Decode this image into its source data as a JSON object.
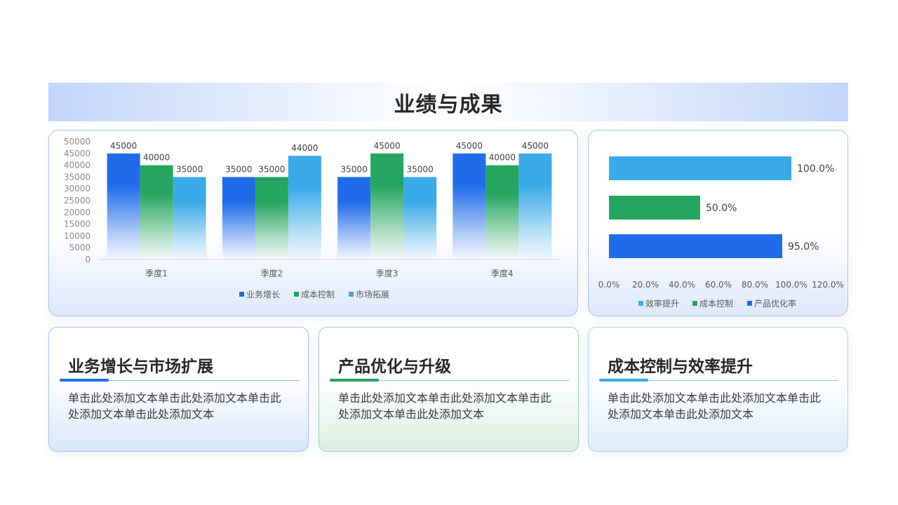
{
  "page": {
    "title": "业绩与成果"
  },
  "chart_data": [
    {
      "type": "bar",
      "categories": [
        "季度1",
        "季度2",
        "季度3",
        "季度4"
      ],
      "series": [
        {
          "name": "业务增长",
          "values": [
            45000,
            35000,
            35000,
            45000
          ],
          "color": "#1f6bea"
        },
        {
          "name": "成本控制",
          "values": [
            40000,
            35000,
            45000,
            40000
          ],
          "color": "#25a55f"
        },
        {
          "name": "市场拓展",
          "values": [
            35000,
            44000,
            35000,
            45000
          ],
          "color": "#3aaae8"
        }
      ],
      "y_ticks": [
        "0",
        "5000",
        "10000",
        "15000",
        "20000",
        "25000",
        "30000",
        "35000",
        "40000",
        "45000",
        "50000"
      ],
      "ylim": [
        0,
        50000
      ],
      "grid": false,
      "legend": "bottom"
    },
    {
      "type": "bar",
      "orientation": "horizontal",
      "categories": [
        "产品优化率",
        "成本控制",
        "效率提升"
      ],
      "values": [
        95.0,
        50.0,
        100.0
      ],
      "value_labels": [
        "95.0%",
        "50.0%",
        "100.0%"
      ],
      "colors": [
        "#1f6bea",
        "#25a55f",
        "#3aaae8"
      ],
      "x_ticks": [
        "0.0%",
        "20.0%",
        "40.0%",
        "60.0%",
        "80.0%",
        "100.0%",
        "120.0%"
      ],
      "xlim": [
        0,
        120
      ],
      "legend_entries": [
        "效率提升",
        "成本控制",
        "产品优化率"
      ],
      "legend": "bottom"
    }
  ],
  "cards": [
    {
      "title": "业务增长与市场扩展",
      "text": "单击此处添加文本单击此处添加文本单击此处添加文本单击此处添加文本"
    },
    {
      "title": "产品优化与升级",
      "text": "单击此处添加文本单击此处添加文本单击此处添加文本单击此处添加文本"
    },
    {
      "title": "成本控制与效率提升",
      "text": "单击此处添加文本单击此处添加文本单击此处添加文本单击此处添加文本"
    }
  ]
}
